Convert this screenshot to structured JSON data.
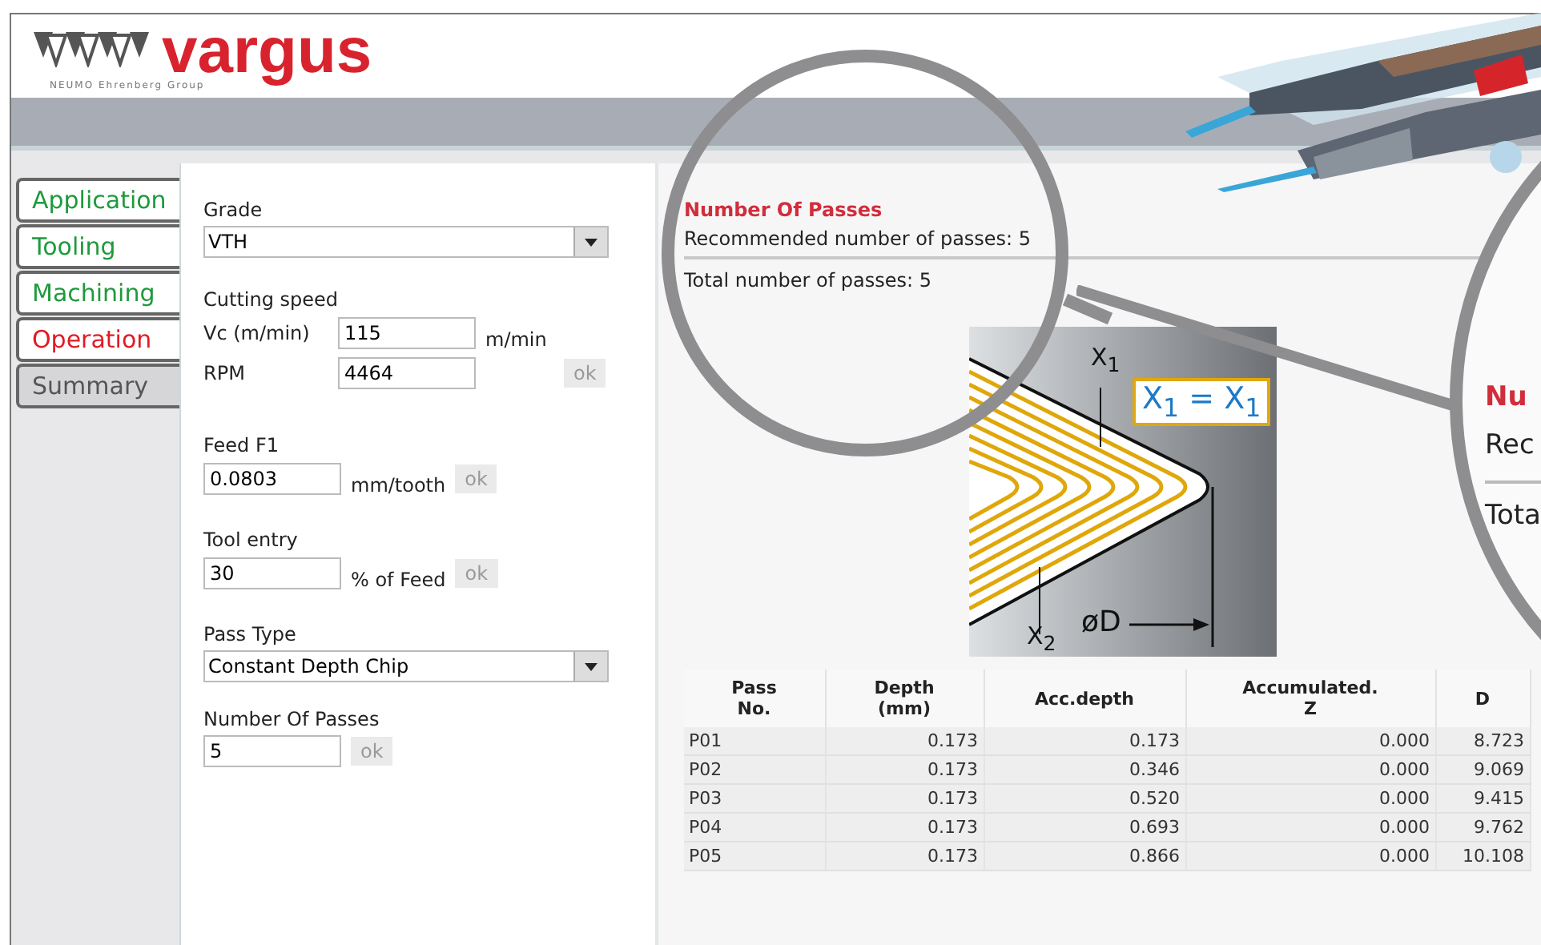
{
  "logo": {
    "brand": "vargus",
    "tagline": "NEUMO Ehrenberg Group"
  },
  "steps": [
    {
      "label": "Application",
      "completed": true,
      "selected": false
    },
    {
      "label": "Tooling",
      "completed": true,
      "selected": false
    },
    {
      "label": "Machining",
      "completed": true,
      "selected": false
    },
    {
      "label": "Operation",
      "completed": false,
      "selected": true
    },
    {
      "label": "Summary",
      "completed": false,
      "selected": false
    }
  ],
  "form": {
    "grade": {
      "label": "Grade",
      "value": "VTH"
    },
    "cutting_speed": {
      "label": "Cutting speed",
      "vc_label": "Vc (m/min)",
      "vc_value": "115",
      "vc_unit": "m/min",
      "rpm_label": "RPM",
      "rpm_value": "4464",
      "button": "ok"
    },
    "feed": {
      "label": "Feed F1",
      "value": "0.0803",
      "unit": "mm/tooth",
      "button": "ok"
    },
    "tool_entry": {
      "label": "Tool entry",
      "value": "30",
      "unit": "% of Feed",
      "button": "ok"
    },
    "pass_type": {
      "label": "Pass Type",
      "value": "Constant Depth Chip"
    },
    "passes": {
      "label": "Number Of Passes",
      "value": "5",
      "button": "ok"
    }
  },
  "results": {
    "title": "Number Of Passes",
    "recommended": "Recommended number of passes: 5",
    "total": "Total number of passes: 5"
  },
  "diagram": {
    "x1": "X$_{1}$",
    "x2": "X$_{2}$",
    "equation": "X$_{1}$ = X$_{1}$",
    "diameter": "øD"
  },
  "table": {
    "columns": [
      "Pass\nNo.",
      "Depth\n(mm)",
      "Acc.depth",
      "Accumulated.\nZ",
      "D"
    ],
    "rows": [
      [
        "P01",
        "0.173",
        "0.173",
        "0.000",
        "8.723"
      ],
      [
        "P02",
        "0.173",
        "0.346",
        "0.000",
        "9.069"
      ],
      [
        "P03",
        "0.173",
        "0.520",
        "0.000",
        "9.415"
      ],
      [
        "P04",
        "0.173",
        "0.693",
        "0.000",
        "9.762"
      ],
      [
        "P05",
        "0.173",
        "0.866",
        "0.000",
        "10.108"
      ]
    ]
  },
  "magnified": {
    "title": "Nu",
    "line_1": "Rec",
    "line_2": "Tota"
  }
}
